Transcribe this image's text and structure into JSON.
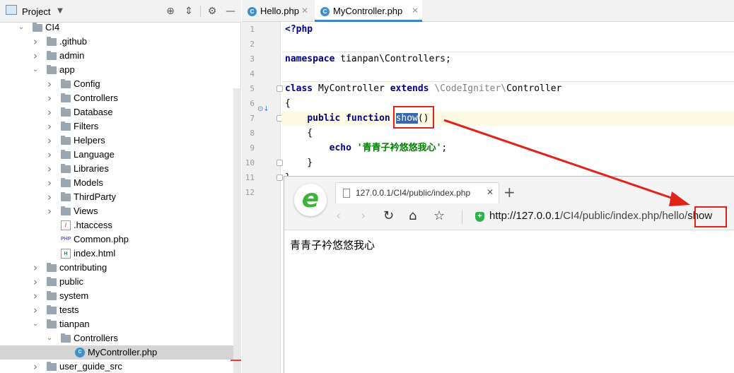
{
  "project": {
    "title": "Project",
    "tree": [
      {
        "label": "CI4",
        "depth": 0,
        "open": true,
        "type": "folder"
      },
      {
        "label": ".github",
        "depth": 1,
        "open": false,
        "type": "folder"
      },
      {
        "label": "admin",
        "depth": 1,
        "open": false,
        "type": "folder"
      },
      {
        "label": "app",
        "depth": 1,
        "open": true,
        "type": "folder"
      },
      {
        "label": "Config",
        "depth": 2,
        "open": false,
        "type": "folder"
      },
      {
        "label": "Controllers",
        "depth": 2,
        "open": false,
        "type": "folder"
      },
      {
        "label": "Database",
        "depth": 2,
        "open": false,
        "type": "folder"
      },
      {
        "label": "Filters",
        "depth": 2,
        "open": false,
        "type": "folder"
      },
      {
        "label": "Helpers",
        "depth": 2,
        "open": false,
        "type": "folder"
      },
      {
        "label": "Language",
        "depth": 2,
        "open": false,
        "type": "folder"
      },
      {
        "label": "Libraries",
        "depth": 2,
        "open": false,
        "type": "folder"
      },
      {
        "label": "Models",
        "depth": 2,
        "open": false,
        "type": "folder"
      },
      {
        "label": "ThirdParty",
        "depth": 2,
        "open": false,
        "type": "folder"
      },
      {
        "label": "Views",
        "depth": 2,
        "open": false,
        "type": "folder"
      },
      {
        "label": ".htaccess",
        "depth": 2,
        "type": "htaccess"
      },
      {
        "label": "Common.php",
        "depth": 2,
        "type": "php"
      },
      {
        "label": "index.html",
        "depth": 2,
        "type": "html"
      },
      {
        "label": "contributing",
        "depth": 1,
        "open": false,
        "type": "folder"
      },
      {
        "label": "public",
        "depth": 1,
        "open": false,
        "type": "folder"
      },
      {
        "label": "system",
        "depth": 1,
        "open": false,
        "type": "folder"
      },
      {
        "label": "tests",
        "depth": 1,
        "open": false,
        "type": "folder"
      },
      {
        "label": "tianpan",
        "depth": 1,
        "open": true,
        "type": "folder"
      },
      {
        "label": "Controllers",
        "depth": 2,
        "open": true,
        "type": "folder"
      },
      {
        "label": "MyController.php",
        "depth": 3,
        "type": "class",
        "selected": true
      },
      {
        "label": "user_guide_src",
        "depth": 1,
        "open": false,
        "type": "folder"
      }
    ]
  },
  "editor": {
    "tabs": [
      {
        "label": "Hello.php",
        "active": false
      },
      {
        "label": "MyController.php",
        "active": true
      }
    ],
    "line_numbers": [
      "1",
      "2",
      "3",
      "4",
      "5",
      "6",
      "7",
      "8",
      "9",
      "10",
      "11",
      "12"
    ],
    "code": {
      "l1": "<?php",
      "l3_kw": "namespace",
      "l3_rest": " tianpan\\Controllers;",
      "l5_kw1": "class",
      "l5_name": " MyController ",
      "l5_kw2": "extends",
      "l5_ns": " \\CodeIgniter\\",
      "l5_base": "Controller",
      "l6": "{",
      "l7_indent": "    ",
      "l7_kw1": "public",
      "l7_kw2": " function ",
      "l7_fn": "show",
      "l7_paren": "()",
      "l8": "    {",
      "l9_indent": "        ",
      "l9_kw": "echo",
      "l9_str": " '青青子衿悠悠我心'",
      "l9_end": ";",
      "l10": "    }",
      "l11": "}"
    }
  },
  "browser": {
    "tab_title": "127.0.0.1/CI4/public/index.php",
    "new_tab": "+",
    "url_host": "http://127.0.0.1",
    "url_path": "/CI4/public/index.php/hello/",
    "url_method": "show",
    "content": "青青子衿悠悠我心",
    "logo": "e"
  },
  "colors": {
    "annotation_red": "#e2231a",
    "selection": "#3a66ab",
    "keyword": "#000080",
    "string": "#008000"
  }
}
